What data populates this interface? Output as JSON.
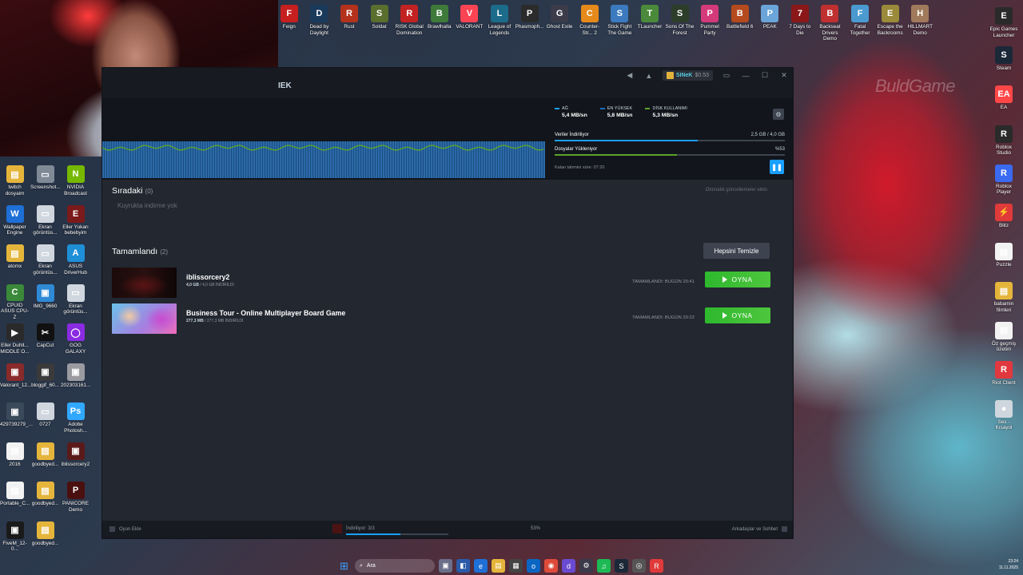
{
  "desktop": {
    "brand_watermark": "BuldGame",
    "top_icons": [
      {
        "label": "Feign",
        "color": "#c61f1f",
        "glyph": "F"
      },
      {
        "label": "Dead by Daylight",
        "color": "#1a3a5c",
        "glyph": "D"
      },
      {
        "label": "Rust",
        "color": "#b4321c",
        "glyph": "R"
      },
      {
        "label": "Soldat",
        "color": "#5a6e2e",
        "glyph": "S"
      },
      {
        "label": "RISK Global Domination",
        "color": "#c32222",
        "glyph": "R"
      },
      {
        "label": "Brawlhalla",
        "color": "#3e7a3a",
        "glyph": "B"
      },
      {
        "label": "VALORANT",
        "color": "#fa4454",
        "glyph": "V"
      },
      {
        "label": "League of Legends",
        "color": "#1c6b8a",
        "glyph": "L"
      },
      {
        "label": "Phasmoph...",
        "color": "#2b2b2b",
        "glyph": "P"
      },
      {
        "label": "Ghost Exile",
        "color": "#3b3b4a",
        "glyph": "G"
      },
      {
        "label": "Counter-Str... 2",
        "color": "#e58a1a",
        "glyph": "C"
      },
      {
        "label": "Stick Fight The Game",
        "color": "#3b7abf",
        "glyph": "S"
      },
      {
        "label": "TLauncher",
        "color": "#4a8a3a",
        "glyph": "T"
      },
      {
        "label": "Sons Of The Forest",
        "color": "#2c3d2a",
        "glyph": "S"
      },
      {
        "label": "Pummel Party",
        "color": "#d43a7a",
        "glyph": "P"
      },
      {
        "label": "Battlefield 6",
        "color": "#b54a1e",
        "glyph": "B"
      },
      {
        "label": "PEAK",
        "color": "#6aa4d8",
        "glyph": "P"
      },
      {
        "label": "7 Days to Die",
        "color": "#8a1818",
        "glyph": "7"
      },
      {
        "label": "Backseat Drivers Demo",
        "color": "#c03030",
        "glyph": "B"
      },
      {
        "label": "Fatal Together",
        "color": "#4a9ad0",
        "glyph": "F"
      },
      {
        "label": "Escape the Backrooms",
        "color": "#9a8a3a",
        "glyph": "E"
      },
      {
        "label": "HILLMART Demo",
        "color": "#a07a5a",
        "glyph": "H"
      }
    ],
    "left_icons": [
      {
        "label": "twitch dosyaim",
        "color": "#e5b53b",
        "glyph": "▤"
      },
      {
        "label": "Screenshot...",
        "color": "#7f8a96",
        "glyph": "▭"
      },
      {
        "label": "NVIDIA Broadcast",
        "color": "#76b900",
        "glyph": "N"
      },
      {
        "label": "Wallpaper Engine",
        "color": "#1e6fd6",
        "glyph": "W"
      },
      {
        "label": "Ekran görüntüs...",
        "color": "#cfd6de",
        "glyph": "▭"
      },
      {
        "label": "Eller Yukarı bebebyim",
        "color": "#7a1a1a",
        "glyph": "E"
      },
      {
        "label": "atomx",
        "color": "#e5b53b",
        "glyph": "▤"
      },
      {
        "label": "Ekran görüntüs...",
        "color": "#cfd6de",
        "glyph": "▭"
      },
      {
        "label": "ASUS DriverHub",
        "color": "#1e8fd6",
        "glyph": "A"
      },
      {
        "label": "CPUID ASUS CPU-Z",
        "color": "#3a8a3a",
        "glyph": "C"
      },
      {
        "label": "IMG_9660",
        "color": "#2f8ad6",
        "glyph": "▣"
      },
      {
        "label": "Ekran görüntüs...",
        "color": "#cfd6de",
        "glyph": "▭"
      },
      {
        "label": "Eller Duhit... MIDDLE O...",
        "color": "#2a2a2a",
        "glyph": "▶"
      },
      {
        "label": "CapCut",
        "color": "#111111",
        "glyph": "✂"
      },
      {
        "label": "GOG GALAXY",
        "color": "#8a2be2",
        "glyph": "◯"
      },
      {
        "label": "Valorant_12...",
        "color": "#8a2a2a",
        "glyph": "▣"
      },
      {
        "label": "bloggif_60...",
        "color": "#3a3a3a",
        "glyph": "▣"
      },
      {
        "label": "202303161...",
        "color": "#9a9aa0",
        "glyph": "▣"
      },
      {
        "label": "429739279_...",
        "color": "#3a4a5a",
        "glyph": "▣"
      },
      {
        "label": "0727",
        "color": "#cfd6de",
        "glyph": "▭"
      },
      {
        "label": "Adobe Photosh...",
        "color": "#31a8ff",
        "glyph": "Ps"
      },
      {
        "label": "2016",
        "color": "#f2f2f2",
        "glyph": "▤"
      },
      {
        "label": "goodbyed...",
        "color": "#e5b53b",
        "glyph": "▤"
      },
      {
        "label": "iblissorcery2",
        "color": "#5a1a1a",
        "glyph": "▣"
      },
      {
        "label": "Portable_C...",
        "color": "#f2f2f2",
        "glyph": "▤"
      },
      {
        "label": "goodbyed...",
        "color": "#e5b53b",
        "glyph": "▤"
      },
      {
        "label": "PANICORE Demo",
        "color": "#4a1010",
        "glyph": "P"
      },
      {
        "label": "FiveM_12-0...",
        "color": "#1a1a1a",
        "glyph": "▣"
      },
      {
        "label": "goodbyed...",
        "color": "#e5b53b",
        "glyph": "▤"
      }
    ],
    "right_icons": [
      {
        "label": "Epic Games Launcher",
        "color": "#2a2a2a",
        "glyph": "E"
      },
      {
        "label": "Steam",
        "color": "#1b2838",
        "glyph": "S"
      },
      {
        "label": "EA",
        "color": "#ff4747",
        "glyph": "EA"
      },
      {
        "label": "Roblox Studio",
        "color": "#2a2a2a",
        "glyph": "R"
      },
      {
        "label": "Roblox Player",
        "color": "#3a6af0",
        "glyph": "R"
      },
      {
        "label": "Blitz",
        "color": "#e03a3a",
        "glyph": "⚡"
      },
      {
        "label": "Puzzle",
        "color": "#f2f2f2",
        "glyph": "▤"
      },
      {
        "label": "babamin filmleri",
        "color": "#e5b53b",
        "glyph": "▤"
      },
      {
        "label": "Öz geçmiş özetim",
        "color": "#f2f2f2",
        "glyph": "▤"
      },
      {
        "label": "Riot Client",
        "color": "#e0383e",
        "glyph": "R"
      },
      {
        "label": "Ses - Kısayol",
        "color": "#cfd6de",
        "glyph": "●"
      }
    ]
  },
  "steam": {
    "window_title": "IEK",
    "user_name": "SINeK",
    "user_balance": "$0.53",
    "stats": [
      {
        "label": "AĞ",
        "value": "5,4 MB/sn",
        "color": "#1a9fff"
      },
      {
        "label": "EN YÜKSEK",
        "value": "5,8 MB/sn",
        "color": "#1a6fbf"
      },
      {
        "label": "DİSK KULLANIMI",
        "value": "5,3 MB/sn",
        "color": "#5ba32b"
      }
    ],
    "downloading_label": "Veriler İndiriliyor",
    "downloading_value": "2,5 GB / 4,0 GB",
    "downloading_progress": 0.62,
    "unpacking_label": "Dosyalar Yükleniyor",
    "unpacking_value": "%53",
    "unpacking_progress": 0.53,
    "eta": "Kalan tahmini süre: 07:20",
    "queue": {
      "title": "Sıradaki",
      "count": "(0)",
      "empty_text": "Kuyrukta indirme yok",
      "auto_updates": "Otomatik güncellemeler etkin"
    },
    "completed": {
      "title": "Tamamlandı",
      "count": "(2)",
      "clear_button": "Hepsini Temizle",
      "games": [
        {
          "name": "iblissorcery2",
          "size_bold": "4,0 GB",
          "size_rest": " / 4,0 GB İNDİRİLDİ",
          "done": "TAMAMLANDI: BUGÜN 20:41",
          "play": "OYNA",
          "thumb": "dark"
        },
        {
          "name": "Business Tour - Online Multiplayer Board Game",
          "size_bold": "277,3 MB",
          "size_rest": " / 277,3 MB İNDİRİLDİ",
          "done": "TAMAMLANDI: BUGÜN 20:22",
          "play": "OYNA",
          "thumb": "colorful"
        }
      ]
    },
    "bottombar": {
      "add_game": "Oyun Ekle",
      "download_status": "İndiriliyor: 3/3",
      "download_pct": "53%",
      "download_progress": 0.53,
      "friends": "Arkadaşlar ve Sohbet"
    }
  },
  "taskbar": {
    "search_placeholder": "Ara",
    "clock": "23:24",
    "date": "11.11.2025"
  }
}
